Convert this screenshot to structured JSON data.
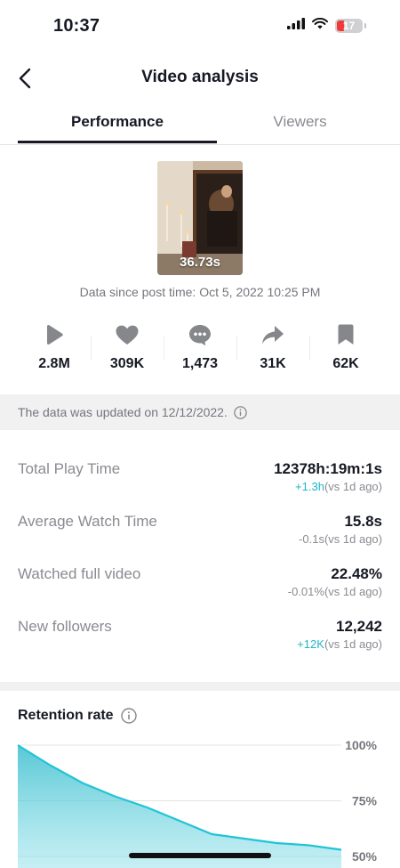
{
  "status_bar": {
    "time": "10:37",
    "battery": "17"
  },
  "header": {
    "title": "Video analysis",
    "back_icon": "chevron-left-icon"
  },
  "tabs": [
    {
      "label": "Performance",
      "active": true
    },
    {
      "label": "Viewers",
      "active": false
    }
  ],
  "video": {
    "duration": "36.73s",
    "post_time": "Data since post time: Oct 5, 2022 10:25 PM"
  },
  "stats": [
    {
      "icon": "play-icon",
      "value": "2.8M"
    },
    {
      "icon": "heart-icon",
      "value": "309K"
    },
    {
      "icon": "comment-icon",
      "value": "1,473"
    },
    {
      "icon": "share-icon",
      "value": "31K"
    },
    {
      "icon": "bookmark-icon",
      "value": "62K"
    }
  ],
  "update_notice": "The data was updated on 12/12/2022.",
  "metrics": [
    {
      "label": "Total Play Time",
      "value": "12378h:19m:1s",
      "delta": "+1.3h",
      "comparison": "(vs 1d ago)",
      "trend": "up"
    },
    {
      "label": "Average Watch Time",
      "value": "15.8s",
      "delta": "-0.1s",
      "comparison": "(vs 1d ago)",
      "trend": "down"
    },
    {
      "label": "Watched full video",
      "value": "22.48%",
      "delta": "-0.01%",
      "comparison": "(vs 1d ago)",
      "trend": "down"
    },
    {
      "label": "New followers",
      "value": "12,242",
      "delta": "+12K",
      "comparison": "(vs 1d ago)",
      "trend": "up"
    }
  ],
  "retention": {
    "title": "Retention rate",
    "chart_data": {
      "type": "area",
      "title": "Retention rate",
      "y_ticks": [
        "100%",
        "75%",
        "50%"
      ],
      "ylim": [
        50,
        100
      ],
      "grid": true,
      "x": [
        0,
        0.5,
        1,
        1.5,
        2,
        2.5,
        3,
        3.5,
        4,
        4.5,
        5
      ],
      "series": [
        {
          "values": [
            100,
            91,
            83,
            77,
            72,
            66,
            60,
            58,
            56,
            55,
            53
          ]
        }
      ]
    }
  },
  "colors": {
    "accent": "#20b6c8",
    "text": "#161823",
    "muted": "#8a8b91",
    "icon": "#86878b"
  }
}
